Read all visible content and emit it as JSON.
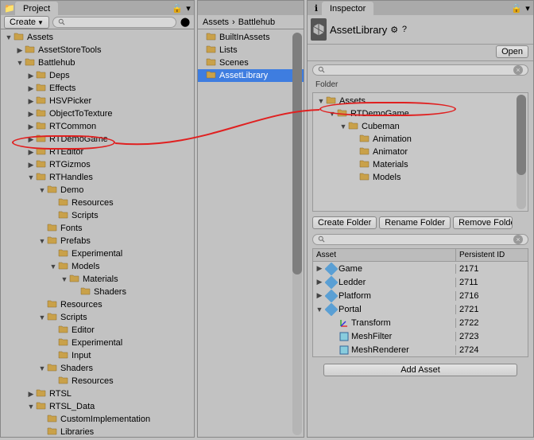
{
  "project": {
    "tab": "Project",
    "create_btn": "Create",
    "tree": [
      {
        "t": 0,
        "f": "d",
        "n": "Assets"
      },
      {
        "t": 1,
        "f": "r",
        "n": "AssetStoreTools"
      },
      {
        "t": 1,
        "f": "d",
        "n": "Battlehub"
      },
      {
        "t": 2,
        "f": "r",
        "n": "Deps"
      },
      {
        "t": 2,
        "f": "r",
        "n": "Effects"
      },
      {
        "t": 2,
        "f": "r",
        "n": "HSVPicker"
      },
      {
        "t": 2,
        "f": "r",
        "n": "ObjectToTexture"
      },
      {
        "t": 2,
        "f": "r",
        "n": "RTCommon"
      },
      {
        "t": 2,
        "f": "r",
        "n": "RTDemoGame",
        "hl": true
      },
      {
        "t": 2,
        "f": "r",
        "n": "RTEditor"
      },
      {
        "t": 2,
        "f": "r",
        "n": "RTGizmos"
      },
      {
        "t": 2,
        "f": "d",
        "n": "RTHandles"
      },
      {
        "t": 3,
        "f": "d",
        "n": "Demo"
      },
      {
        "t": 4,
        "f": "",
        "n": "Resources"
      },
      {
        "t": 4,
        "f": "",
        "n": "Scripts"
      },
      {
        "t": 3,
        "f": "",
        "n": "Fonts"
      },
      {
        "t": 3,
        "f": "d",
        "n": "Prefabs"
      },
      {
        "t": 4,
        "f": "",
        "n": "Experimental"
      },
      {
        "t": 4,
        "f": "d",
        "n": "Models"
      },
      {
        "t": 5,
        "f": "d",
        "n": "Materials"
      },
      {
        "t": 6,
        "f": "",
        "n": "Shaders"
      },
      {
        "t": 3,
        "f": "",
        "n": "Resources"
      },
      {
        "t": 3,
        "f": "d",
        "n": "Scripts"
      },
      {
        "t": 4,
        "f": "",
        "n": "Editor"
      },
      {
        "t": 4,
        "f": "",
        "n": "Experimental"
      },
      {
        "t": 4,
        "f": "",
        "n": "Input"
      },
      {
        "t": 3,
        "f": "d",
        "n": "Shaders"
      },
      {
        "t": 4,
        "f": "",
        "n": "Resources"
      },
      {
        "t": 2,
        "f": "r",
        "n": "RTSL"
      },
      {
        "t": 2,
        "f": "d",
        "n": "RTSL_Data"
      },
      {
        "t": 3,
        "f": "",
        "n": "CustomImplementation"
      },
      {
        "t": 3,
        "f": "",
        "n": "Libraries"
      }
    ]
  },
  "mid": {
    "breadcrumb": [
      "Assets",
      "Battlehub"
    ],
    "items": [
      {
        "n": "BuiltInAssets"
      },
      {
        "n": "Lists"
      },
      {
        "n": "Scenes"
      },
      {
        "n": "AssetLibrary",
        "sel": true
      }
    ]
  },
  "inspector": {
    "tab": "Inspector",
    "title": "AssetLibrary",
    "open_btn": "Open",
    "folder_label": "Folder",
    "folder_tree": [
      {
        "t": 0,
        "f": "d",
        "n": "Assets",
        "hl": true
      },
      {
        "t": 1,
        "f": "d",
        "n": "RTDemoGame"
      },
      {
        "t": 2,
        "f": "d",
        "n": "Cubeman"
      },
      {
        "t": 3,
        "f": "",
        "n": "Animation"
      },
      {
        "t": 3,
        "f": "",
        "n": "Animator"
      },
      {
        "t": 3,
        "f": "",
        "n": "Materials"
      },
      {
        "t": 3,
        "f": "",
        "n": "Models"
      }
    ],
    "btns": {
      "create": "Create Folder",
      "rename": "Rename Folder",
      "remove": "Remove Folder"
    },
    "table_hdr": {
      "asset": "Asset",
      "id": "Persistent ID"
    },
    "assets": [
      {
        "f": "r",
        "type": "prefab",
        "n": "Game",
        "id": "2171"
      },
      {
        "f": "r",
        "type": "prefab",
        "n": "Ledder",
        "id": "2711"
      },
      {
        "f": "r",
        "type": "prefab",
        "n": "Platform",
        "id": "2716"
      },
      {
        "f": "d",
        "type": "prefab",
        "n": "Portal",
        "id": "2721"
      },
      {
        "f": "",
        "type": "transform",
        "n": "Transform",
        "id": "2722",
        "indent": 1
      },
      {
        "f": "",
        "type": "mesh",
        "n": "MeshFilter",
        "id": "2723",
        "indent": 1
      },
      {
        "f": "",
        "type": "mesh",
        "n": "MeshRenderer",
        "id": "2724",
        "indent": 1
      }
    ],
    "add_btn": "Add Asset"
  }
}
